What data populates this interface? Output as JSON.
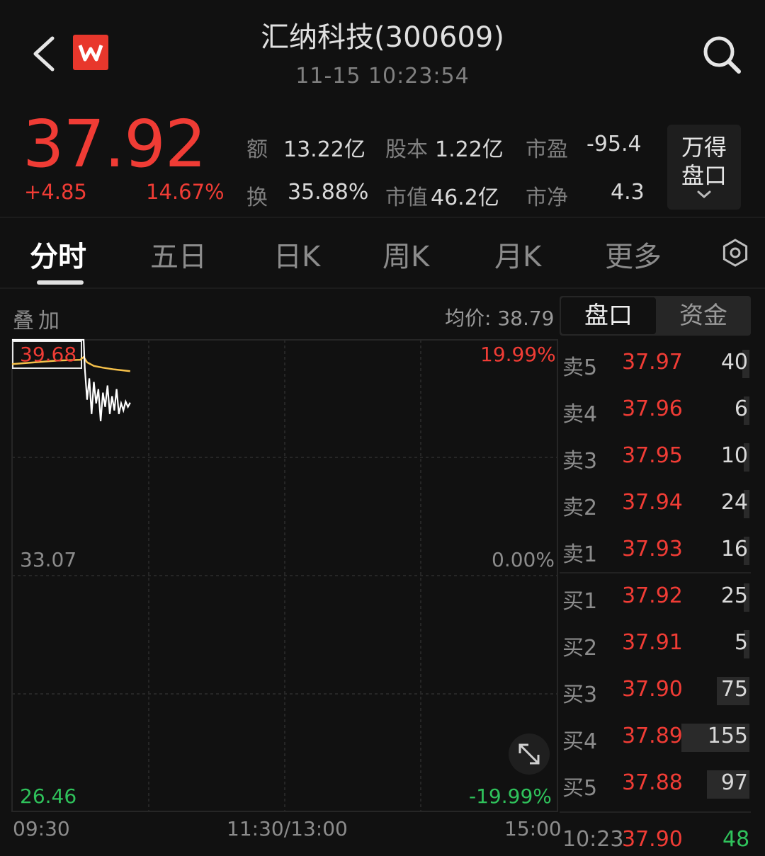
{
  "header": {
    "back_icon": "chevron-left-icon",
    "logo_icon": "wind-w-logo",
    "title": "汇纳科技(300609)",
    "datetime": "11-15 10:23:54",
    "search_icon": "search-icon"
  },
  "quote": {
    "price": "37.92",
    "change": "+4.85",
    "change_pct": "14.67%",
    "stats": [
      {
        "label": "额",
        "value": "13.22亿"
      },
      {
        "label": "股本",
        "value": "1.22亿"
      },
      {
        "label": "市盈",
        "value": "-95.4"
      },
      {
        "label": "换",
        "value": "35.88%"
      },
      {
        "label": "市值",
        "value": "46.2亿"
      },
      {
        "label": "市净",
        "value": "4.3"
      }
    ],
    "wande_line1": "万得",
    "wande_line2": "盘口"
  },
  "tabs": [
    {
      "label": "分时",
      "active": true
    },
    {
      "label": "五日",
      "active": false
    },
    {
      "label": "日K",
      "active": false
    },
    {
      "label": "周K",
      "active": false
    },
    {
      "label": "月K",
      "active": false
    },
    {
      "label": "更多",
      "active": false
    }
  ],
  "chart": {
    "overlay_label": "叠加",
    "avg_price_label": "均价: 38.79",
    "y_left_top": "39.68",
    "y_left_mid": "33.07",
    "y_left_bottom": "26.46",
    "y_right_top": "19.99%",
    "y_right_mid": "0.00%",
    "y_right_bottom": "-19.99%",
    "time_start": "09:30",
    "time_mid": "11:30/13:00",
    "time_end": "15:00"
  },
  "chart_data": {
    "type": "line",
    "ylim": [
      26.46,
      39.68
    ],
    "x_range_minutes": [
      0,
      240
    ],
    "series": [
      {
        "role": "price",
        "color": "#ffffff",
        "points": [
          [
            0,
            39.68
          ],
          [
            1,
            39.68
          ],
          [
            2,
            39.68
          ],
          [
            3,
            39.68
          ],
          [
            4,
            39.68
          ],
          [
            5,
            39.68
          ],
          [
            6,
            39.68
          ],
          [
            7,
            39.68
          ],
          [
            8,
            39.68
          ],
          [
            9,
            39.68
          ],
          [
            10,
            39.68
          ],
          [
            11,
            39.68
          ],
          [
            12,
            39.68
          ],
          [
            13,
            39.68
          ],
          [
            14,
            39.68
          ],
          [
            15,
            39.68
          ],
          [
            16,
            39.68
          ],
          [
            17,
            39.68
          ],
          [
            18,
            39.68
          ],
          [
            19,
            39.68
          ],
          [
            20,
            39.68
          ],
          [
            21,
            39.68
          ],
          [
            22,
            39.68
          ],
          [
            23,
            39.68
          ],
          [
            24,
            39.68
          ],
          [
            25,
            39.68
          ],
          [
            26,
            39.68
          ],
          [
            27,
            39.68
          ],
          [
            28,
            39.68
          ],
          [
            29,
            39.68
          ],
          [
            30,
            39.68
          ],
          [
            31,
            39.68
          ],
          [
            31.5,
            39.68
          ],
          [
            32,
            38.9
          ],
          [
            33,
            38.0
          ],
          [
            34,
            38.6
          ],
          [
            35,
            37.6
          ],
          [
            36,
            38.5
          ],
          [
            37,
            37.9
          ],
          [
            38,
            38.3
          ],
          [
            39,
            37.4
          ],
          [
            40,
            38.2
          ],
          [
            41,
            37.8
          ],
          [
            42,
            38.4
          ],
          [
            43,
            37.6
          ],
          [
            44,
            38.1
          ],
          [
            45,
            37.7
          ],
          [
            46,
            38.3
          ],
          [
            47,
            37.6
          ],
          [
            48,
            37.9
          ],
          [
            49,
            37.7
          ],
          [
            50,
            37.95
          ],
          [
            51,
            37.8
          ],
          [
            52,
            37.92
          ]
        ]
      },
      {
        "role": "average",
        "color": "#f5c04a",
        "points": [
          [
            0,
            39.0
          ],
          [
            10,
            39.05
          ],
          [
            20,
            39.1
          ],
          [
            30,
            39.12
          ],
          [
            31.5,
            39.2
          ],
          [
            33,
            39.05
          ],
          [
            36,
            38.95
          ],
          [
            40,
            38.9
          ],
          [
            45,
            38.85
          ],
          [
            52,
            38.8
          ]
        ]
      }
    ]
  },
  "orderbook": {
    "tabs": [
      "盘口",
      "资金"
    ],
    "rows": [
      {
        "label": "卖5",
        "price": "37.97",
        "vol": "40",
        "bar": 0.1
      },
      {
        "label": "卖4",
        "price": "37.96",
        "vol": "6",
        "bar": 0.02
      },
      {
        "label": "卖3",
        "price": "37.95",
        "vol": "10",
        "bar": 0.05
      },
      {
        "label": "卖2",
        "price": "37.94",
        "vol": "24",
        "bar": 0.07
      },
      {
        "label": "卖1",
        "price": "37.93",
        "vol": "16",
        "bar": 0.07
      },
      {
        "label": "买1",
        "price": "37.92",
        "vol": "25",
        "bar": 0.08
      },
      {
        "label": "买2",
        "price": "37.91",
        "vol": "5",
        "bar": 0.02
      },
      {
        "label": "买3",
        "price": "37.90",
        "vol": "75",
        "bar": 0.48
      },
      {
        "label": "买4",
        "price": "37.89",
        "vol": "155",
        "bar": 1.0
      },
      {
        "label": "买5",
        "price": "37.88",
        "vol": "97",
        "bar": 0.62
      }
    ],
    "last_trade": {
      "time": "10:23",
      "price": "37.90",
      "vol": "48"
    }
  },
  "colors": {
    "up": "#f03c35",
    "down": "#2fc25b",
    "avg": "#f5c04a",
    "bg": "#111111"
  }
}
